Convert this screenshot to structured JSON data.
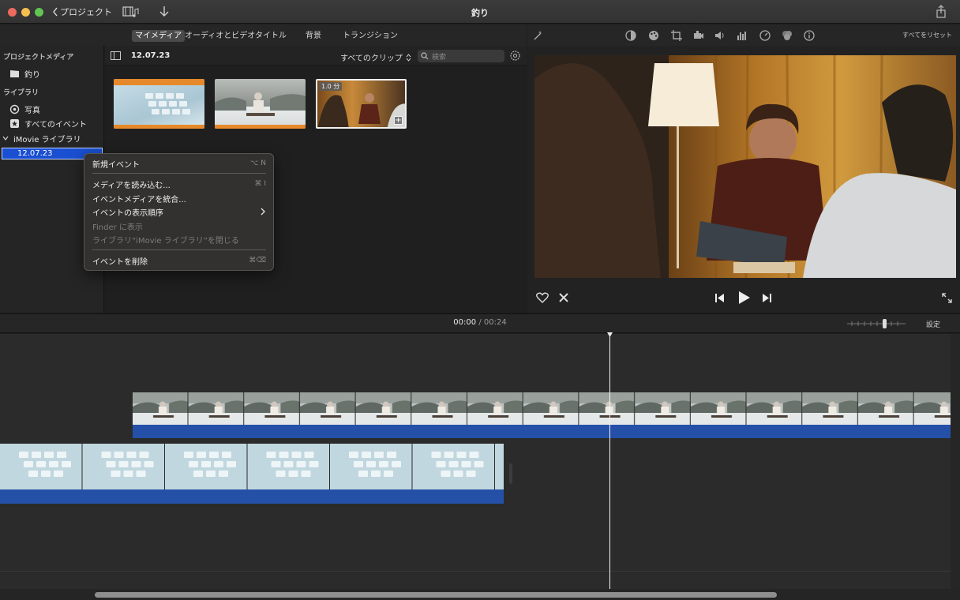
{
  "window": {
    "title": "釣り",
    "back_label": "プロジェクト"
  },
  "browser_tabs": [
    {
      "label": "マイメディア",
      "active": true
    },
    {
      "label": "オーディオとビデオ",
      "active": false
    },
    {
      "label": "タイトル",
      "active": false
    },
    {
      "label": "背景",
      "active": false
    },
    {
      "label": "トランジション",
      "active": false
    }
  ],
  "sidebar": {
    "project_media_header": "プロジェクトメディア",
    "project_item": "釣り",
    "library_header": "ライブラリ",
    "photos_item": "写真",
    "all_events_item": "すべてのイベント",
    "library_name": "iMovie ライブラリ",
    "selected_event": "12.07.23"
  },
  "media_toolbar": {
    "event_title": "12.07.23",
    "filter_label": "すべてのクリップ",
    "search_placeholder": "検索"
  },
  "thumbnails": [
    {
      "kind": "keyboard"
    },
    {
      "kind": "fisherman"
    },
    {
      "kind": "interview",
      "badge": "1.0 分"
    }
  ],
  "context_menu": {
    "items": [
      {
        "label": "新規イベント",
        "shortcut": "⌥ N",
        "enabled": true
      },
      {
        "label": "メディアを読み込む...",
        "shortcut": "⌘ I",
        "enabled": true
      },
      {
        "label": "イベントメディアを統合...",
        "shortcut": "",
        "enabled": true
      },
      {
        "label": "イベントの表示順序",
        "shortcut": "",
        "enabled": true,
        "submenu": true
      },
      {
        "label": "Finder に表示",
        "shortcut": "",
        "enabled": false
      },
      {
        "label": "ライブラリ“iMovie ライブラリ”を閉じる",
        "shortcut": "",
        "enabled": false
      },
      {
        "label": "イベントを削除",
        "shortcut": "⌘⌫",
        "enabled": true
      }
    ]
  },
  "viewer": {
    "reset_label": "すべてをリセット"
  },
  "timeline": {
    "current_time": "00:00",
    "separator": "/",
    "total_time": "00:24",
    "settings_label": "設定"
  },
  "colors": {
    "selection_blue": "#1a4fd1",
    "clip_blue": "#2450a8",
    "accent_orange": "#e6892a"
  }
}
